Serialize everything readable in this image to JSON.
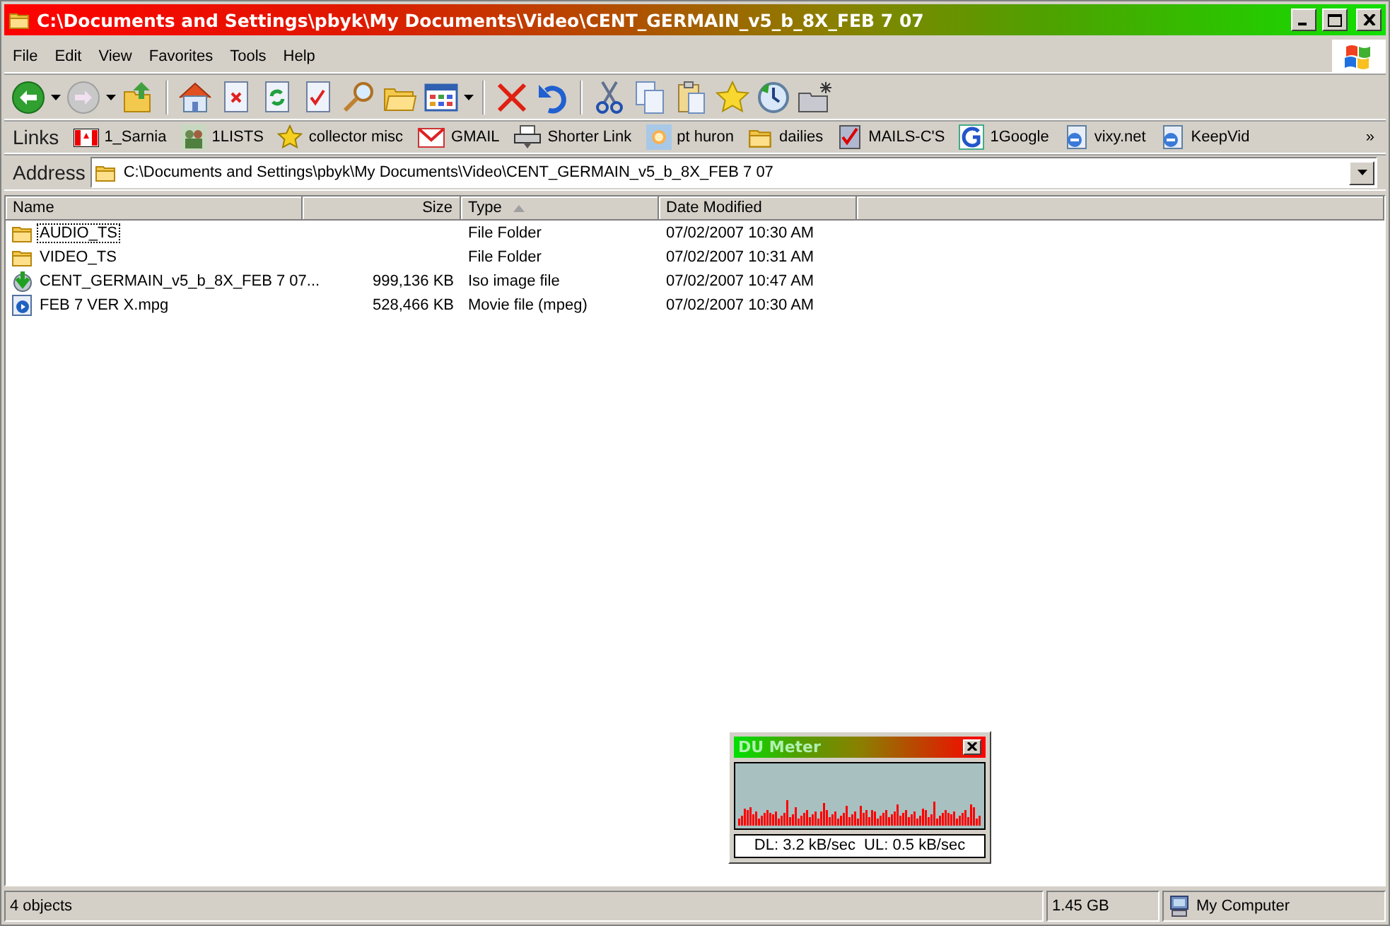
{
  "window": {
    "title": "C:\\Documents and Settings\\pbyk\\My Documents\\Video\\CENT_GERMAIN_v5_b_8X_FEB 7 07"
  },
  "menu": [
    "File",
    "Edit",
    "View",
    "Favorites",
    "Tools",
    "Help"
  ],
  "links": {
    "label": "Links",
    "items": [
      "1_Sarnia",
      "1LISTS",
      "collector misc",
      "GMAIL",
      "Shorter Link",
      "pt huron",
      "dailies",
      "MAILS-C'S",
      "1Google",
      "vixy.net",
      "KeepVid"
    ],
    "overflow": "»"
  },
  "address": {
    "label": "Address",
    "value": "C:\\Documents and Settings\\pbyk\\My Documents\\Video\\CENT_GERMAIN_v5_b_8X_FEB 7 07"
  },
  "file_list": {
    "columns": [
      {
        "label": "Name",
        "sorted": false
      },
      {
        "label": "Size",
        "sorted": false
      },
      {
        "label": "Type",
        "sorted": true
      },
      {
        "label": "Date Modified",
        "sorted": false
      }
    ],
    "rows": [
      {
        "name": "AUDIO_TS",
        "type": "File Folder",
        "date": "07/02/2007 10:30 AM",
        "kind": "folder",
        "focused": true
      },
      {
        "name": "VIDEO_TS",
        "type": "File Folder",
        "date": "07/02/2007 10:31 AM",
        "kind": "folder",
        "focused": false
      },
      {
        "name": "CENT_GERMAIN_v5_b_8X_FEB 7 07...",
        "size": "999,136 KB",
        "type": "Iso image file",
        "date": "07/02/2007 10:47 AM",
        "kind": "iso",
        "focused": false
      },
      {
        "name": "FEB 7 VER X.mpg",
        "size": "528,466 KB",
        "type": "Movie file (mpeg)",
        "date": "07/02/2007 10:30 AM",
        "kind": "movie",
        "focused": false
      }
    ]
  },
  "du_meter": {
    "title": "DU Meter",
    "reading": "DL: 3.2 kB/sec  UL: 0.5 kB/sec"
  },
  "status_bar": {
    "objects": "4 objects",
    "size": "1.45 GB",
    "zone": "My Computer"
  }
}
